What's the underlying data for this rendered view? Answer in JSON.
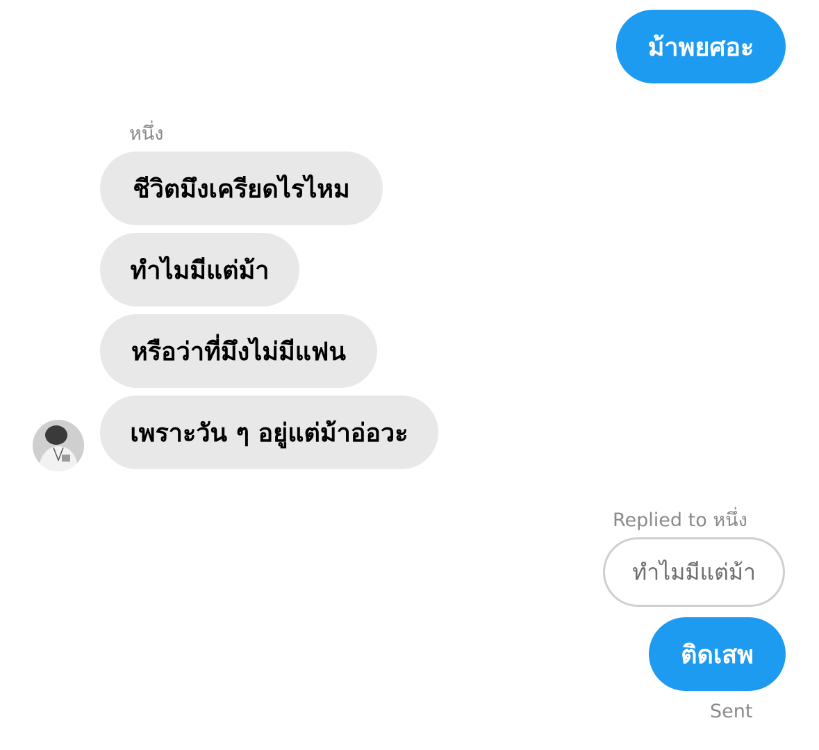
{
  "conversation": {
    "messages": [
      {
        "side": "outgoing",
        "text": "ม้าพยศอะ"
      },
      {
        "side": "incoming",
        "text": "ชีวิตมึงเครียดไรไหม"
      },
      {
        "side": "incoming",
        "text": "ทำไมมีแต่ม้า"
      },
      {
        "side": "incoming",
        "text": "หรือว่าที่มึงไม่มีแฟน"
      },
      {
        "side": "incoming",
        "text": "เพราะวัน ๆ อยู่แต่ม้าอ่อวะ"
      },
      {
        "side": "outgoing",
        "text": "ติดเสพ"
      }
    ],
    "sender_name": "หนึ่ง",
    "reply": {
      "label": "Replied to หนึ่ง",
      "quoted_text": "ทำไมมีแต่ม้า"
    },
    "status": "Sent"
  },
  "colors": {
    "outgoing_bubble": "#1d9bf0",
    "incoming_bubble": "#e8e8e8",
    "meta_text": "#8a8a8a"
  },
  "icons": {
    "avatar": "user-avatar-photo"
  }
}
